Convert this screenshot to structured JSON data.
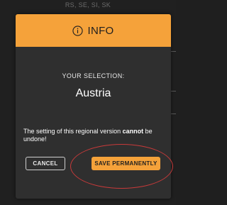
{
  "background": {
    "top_text": "RS, SE, SI, SK"
  },
  "dialog": {
    "title": "INFO",
    "selection_label": "YOUR SELECTION:",
    "selection_value": "Austria",
    "warning_before": "The setting of this regional version ",
    "warning_strong": "cannot",
    "warning_after": " be undone!",
    "cancel_label": "CANCEL",
    "save_label": "SAVE PERMANENTLY"
  },
  "colors": {
    "accent": "#f5a23a",
    "panel": "#2f2f2f",
    "annotation": "#c83a3a"
  },
  "icons": {
    "header": "info-circle-icon"
  }
}
